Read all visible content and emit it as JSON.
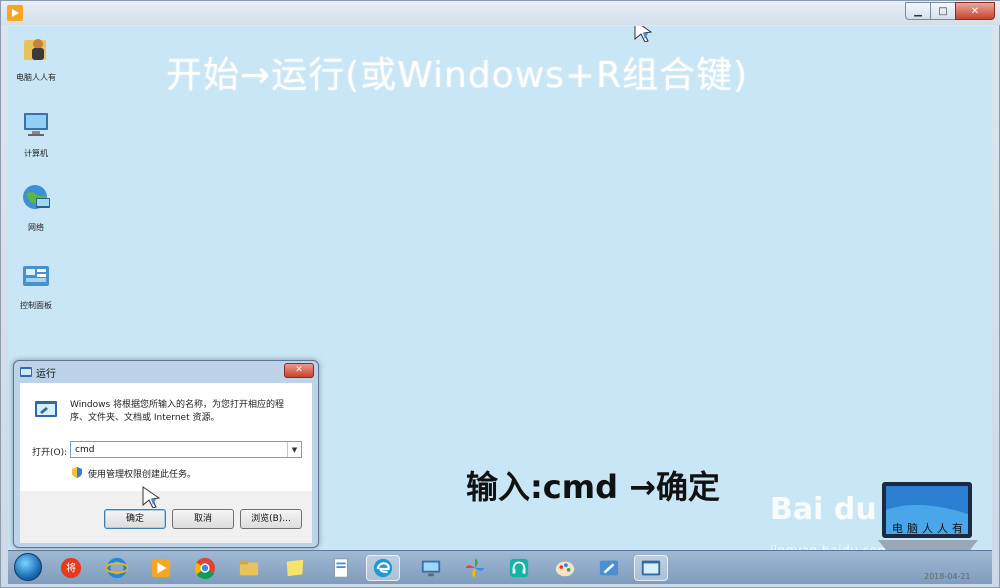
{
  "window": {
    "controls": {
      "minimize": "▁",
      "maximize": "□",
      "close": "✕"
    }
  },
  "desktop": {
    "icons": [
      {
        "label": "电脑人人有",
        "icon": "user-folder-icon"
      },
      {
        "label": "计算机",
        "icon": "computer-icon"
      },
      {
        "label": "网络",
        "icon": "network-globe-icon"
      },
      {
        "label": "控制面板",
        "icon": "control-panel-icon"
      }
    ],
    "headline": "开始→运行(或Windows+R组合键)",
    "instruction": "输入:cmd  →确定"
  },
  "run_dialog": {
    "title": "运行",
    "close": "✕",
    "description": "Windows 将根据您所输入的名称，为您打开相应的程序、文件夹、文档或 Internet 资源。",
    "open_label": "打开(O):",
    "input_value": "cmd",
    "admin_note": "使用管理权限创建此任务。",
    "buttons": {
      "ok": "确定",
      "cancel": "取消",
      "browse": "浏览(B)..."
    }
  },
  "watermark": {
    "logo": "Bai du 经验",
    "url": "jingyan.baidu.com",
    "laptop_caption": "电脑人人有",
    "timestamp": "2018-04-21"
  },
  "taskbar": {
    "items": [
      "start-orb-icon",
      "jiangjiang-icon",
      "ie-icon",
      "media-player-icon",
      "chrome-icon",
      "explorer-folder-icon",
      "sticky-notes-icon",
      "document-icon",
      "edge-browser-icon",
      "remote-desktop-icon",
      "pinwheel-icon",
      "headset-icon",
      "paint-icon",
      "windows-app-icon",
      "run-dialog-icon"
    ]
  },
  "colors": {
    "desktop_bg": "#c9e6f6",
    "close_red": "#c8412b",
    "taskbar": "#8fabca"
  }
}
